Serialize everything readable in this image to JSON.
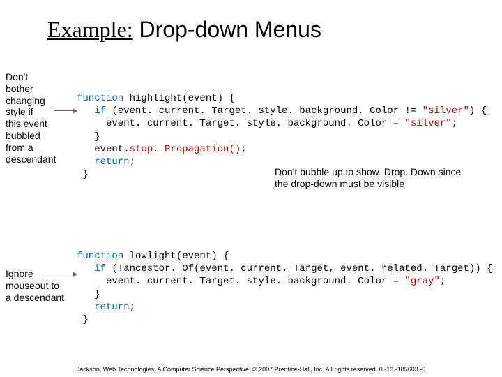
{
  "title": {
    "ul": "Example:",
    "rest": " Drop-down Menus"
  },
  "annot": {
    "left1": "Don't\nbother\nchanging\nstyle if\nthis event\nbubbled\nfrom a\ndescendant",
    "right1": "Don't bubble up to show. Drop. Down since\nthe drop-down must be visible",
    "left2": "Ignore\nmouseout to\na descendant"
  },
  "code": {
    "l1a": "function",
    "l1b": " highlight(event) {",
    "l2a": "   if",
    "l2b": " (event. current. Target. style. background. Color != ",
    "l2c": "\"silver\"",
    "l2d": ") {",
    "l3a": "     event. current. Target. style. background. Color = ",
    "l3b": "\"silver\"",
    "l3c": ";",
    "l4": "   }",
    "l5a": "   event.",
    "l5b": "stop. Propagation()",
    "l5c": ";",
    "l6a": "   return",
    "l6b": ";",
    "l7": " }",
    "l8a": "function",
    "l8b": " lowlight(event) {",
    "l9a": "   if",
    "l9b": " (!ancestor. Of(event. current. Target, event. related. Target)) {",
    "l10a": "     event. current. Target. style. background. Color = ",
    "l10b": "\"gray\"",
    "l10c": ";",
    "l11": "   }",
    "l12a": "   return",
    "l12b": ";",
    "l13": " }"
  },
  "footer": "Jackson, Web Technologies: A Computer Science Perspective, © 2007 Prentice-Hall, Inc. All rights reserved. 0 -13 -185603 -0"
}
